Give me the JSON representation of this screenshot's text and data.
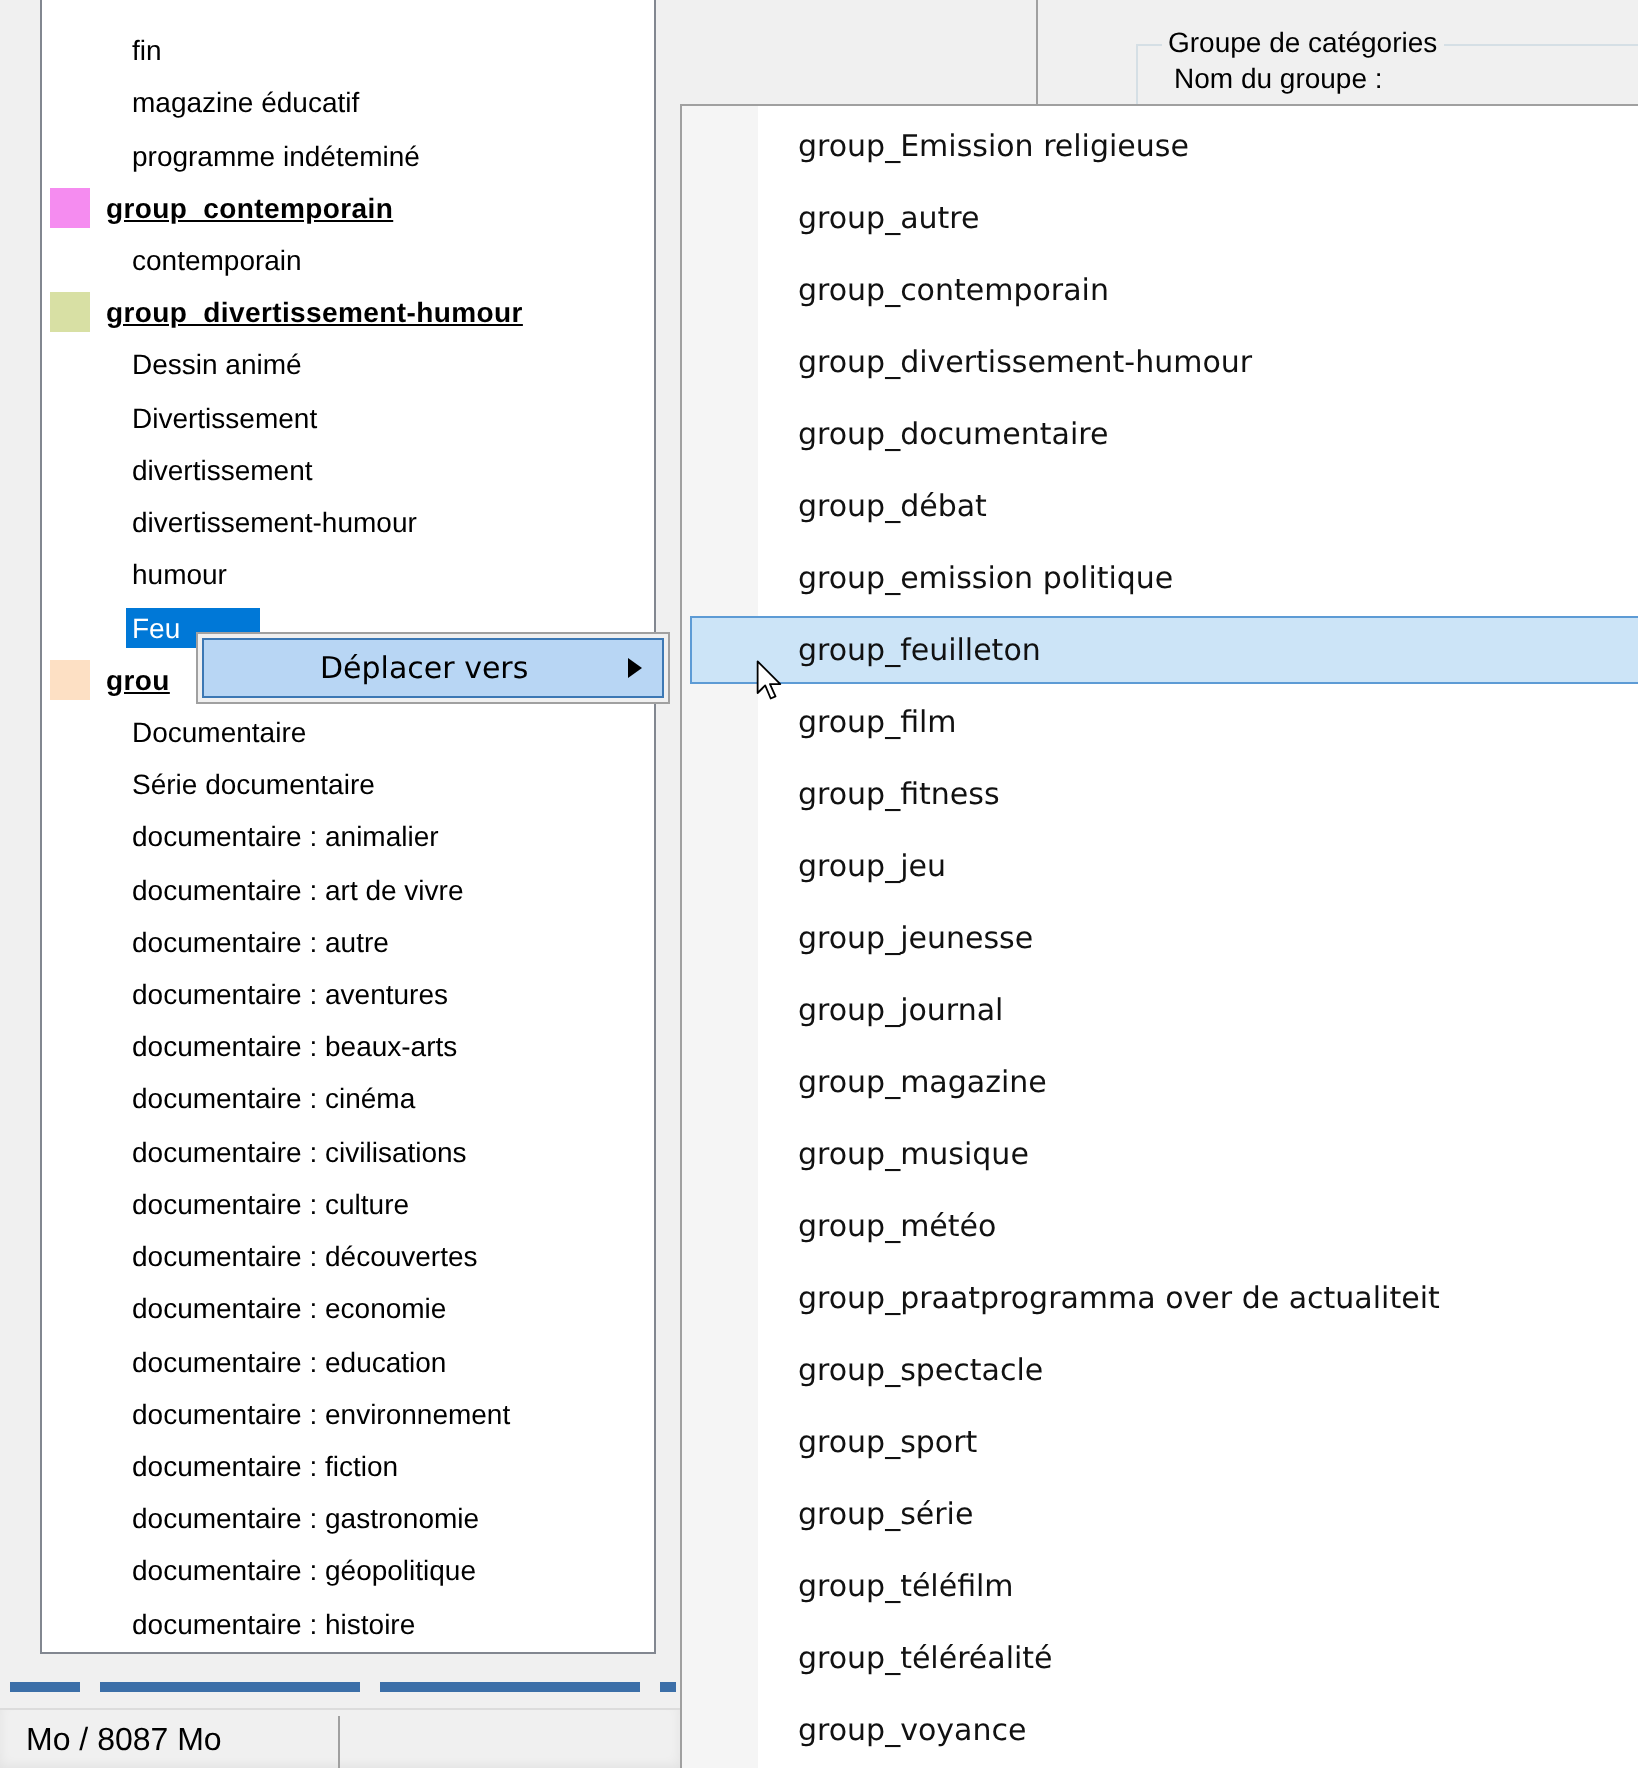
{
  "tree": {
    "items": [
      {
        "kind": "item",
        "label": "fin",
        "selected": false
      },
      {
        "kind": "item",
        "label": "magazine éducatif",
        "selected": false
      },
      {
        "kind": "item",
        "label": "programme indéteminé",
        "selected": false
      },
      {
        "kind": "group",
        "label": "group_contemporain",
        "color": "#f58cf0",
        "selected": false
      },
      {
        "kind": "item",
        "label": "contemporain",
        "selected": false
      },
      {
        "kind": "group",
        "label": "group_divertissement-humour",
        "color": "#d8e0a4",
        "selected": false
      },
      {
        "kind": "item",
        "label": "Dessin animé",
        "selected": false
      },
      {
        "kind": "item",
        "label": "Divertissement",
        "selected": false
      },
      {
        "kind": "item",
        "label": "divertissement",
        "selected": false
      },
      {
        "kind": "item",
        "label": "divertissement-humour",
        "selected": false
      },
      {
        "kind": "item",
        "label": "humour",
        "selected": false
      },
      {
        "kind": "item",
        "label": "Feu",
        "selected": true
      },
      {
        "kind": "group",
        "label": "grou",
        "color": "#fde0c4",
        "selected": false
      },
      {
        "kind": "item",
        "label": "Documentaire",
        "selected": false
      },
      {
        "kind": "item",
        "label": "Série documentaire",
        "selected": false
      },
      {
        "kind": "item",
        "label": "documentaire : animalier",
        "selected": false
      },
      {
        "kind": "item",
        "label": "documentaire : art de vivre",
        "selected": false
      },
      {
        "kind": "item",
        "label": "documentaire : autre",
        "selected": false
      },
      {
        "kind": "item",
        "label": "documentaire : aventures",
        "selected": false
      },
      {
        "kind": "item",
        "label": "documentaire : beaux-arts",
        "selected": false
      },
      {
        "kind": "item",
        "label": "documentaire : cinéma",
        "selected": false
      },
      {
        "kind": "item",
        "label": "documentaire : civilisations",
        "selected": false
      },
      {
        "kind": "item",
        "label": "documentaire : culture",
        "selected": false
      },
      {
        "kind": "item",
        "label": "documentaire : découvertes",
        "selected": false
      },
      {
        "kind": "item",
        "label": "documentaire : economie",
        "selected": false
      },
      {
        "kind": "item",
        "label": "documentaire : education",
        "selected": false
      },
      {
        "kind": "item",
        "label": "documentaire : environnement",
        "selected": false
      },
      {
        "kind": "item",
        "label": "documentaire : fiction",
        "selected": false
      },
      {
        "kind": "item",
        "label": "documentaire : gastronomie",
        "selected": false
      },
      {
        "kind": "item",
        "label": "documentaire : géopolitique",
        "selected": false
      },
      {
        "kind": "item",
        "label": "documentaire : histoire",
        "selected": false
      }
    ]
  },
  "group_box": {
    "title": "Groupe de catégories",
    "label": "Nom du groupe :"
  },
  "status_bar": {
    "memory": "Mo / 8087 Mo"
  },
  "context_menu": {
    "items": [
      {
        "label": "Déplacer vers",
        "has_submenu": true,
        "selected": true
      }
    ]
  },
  "submenu": {
    "items": [
      {
        "label": "group_Emission religieuse",
        "selected": false
      },
      {
        "label": "group_autre",
        "selected": false
      },
      {
        "label": "group_contemporain",
        "selected": false
      },
      {
        "label": "group_divertissement-humour",
        "selected": false
      },
      {
        "label": "group_documentaire",
        "selected": false
      },
      {
        "label": "group_débat",
        "selected": false
      },
      {
        "label": "group_emission politique",
        "selected": false
      },
      {
        "label": "group_feuilleton",
        "selected": true
      },
      {
        "label": "group_film",
        "selected": false
      },
      {
        "label": "group_fitness",
        "selected": false
      },
      {
        "label": "group_jeu",
        "selected": false
      },
      {
        "label": "group_jeunesse",
        "selected": false
      },
      {
        "label": "group_journal",
        "selected": false
      },
      {
        "label": "group_magazine",
        "selected": false
      },
      {
        "label": "group_musique",
        "selected": false
      },
      {
        "label": "group_météo",
        "selected": false
      },
      {
        "label": "group_praatprogramma over de actualiteit",
        "selected": false
      },
      {
        "label": "group_spectacle",
        "selected": false
      },
      {
        "label": "group_sport",
        "selected": false
      },
      {
        "label": "group_série",
        "selected": false
      },
      {
        "label": "group_téléfilm",
        "selected": false
      },
      {
        "label": "group_téléréalité",
        "selected": false
      },
      {
        "label": "group_voyance",
        "selected": false
      }
    ]
  }
}
